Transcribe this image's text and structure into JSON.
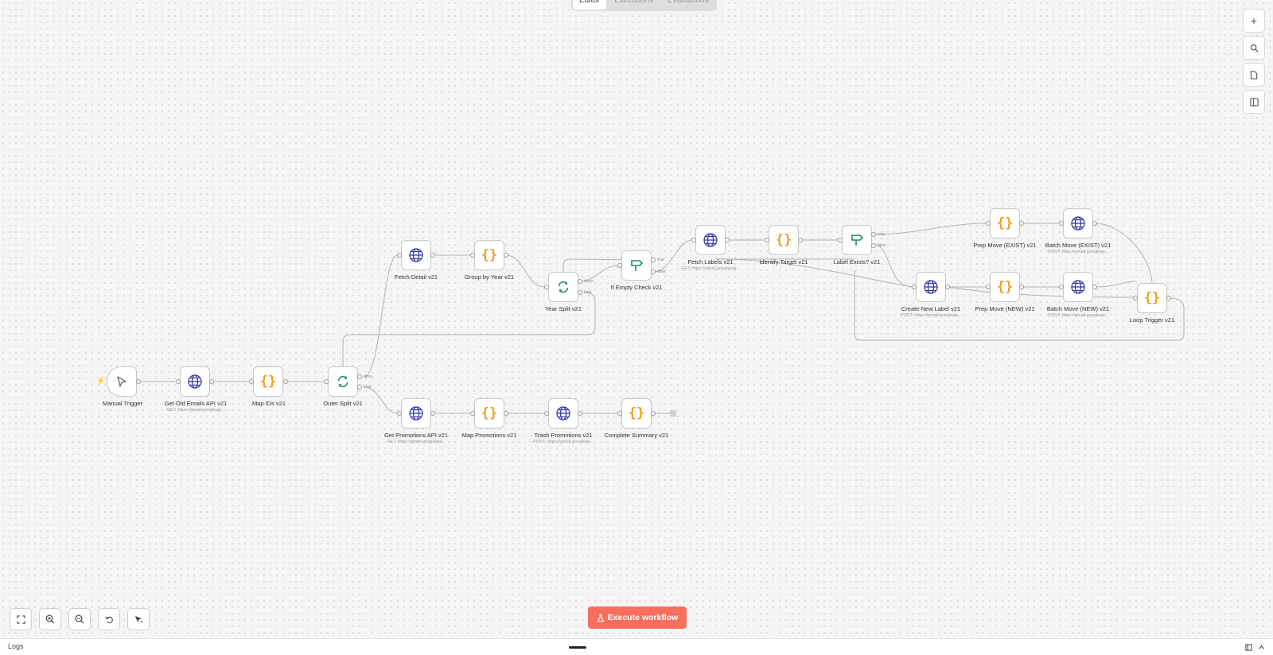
{
  "tabs": [
    "Editor",
    "Executions",
    "Evaluations"
  ],
  "canvas_tools": {
    "right": [
      {
        "name": "add-node-button",
        "icon": "plus-icon"
      },
      {
        "name": "search-nodes-button",
        "icon": "search-icon"
      },
      {
        "name": "sticky-note-button",
        "icon": "note-icon"
      },
      {
        "name": "toggle-panel-button",
        "icon": "panel-icon"
      }
    ],
    "bottom": [
      {
        "name": "zoom-to-fit-button",
        "icon": "fullscreen-icon"
      },
      {
        "name": "zoom-in-button",
        "icon": "zoom-in-icon"
      },
      {
        "name": "zoom-out-button",
        "icon": "zoom-out-icon"
      },
      {
        "name": "reset-zoom-button",
        "icon": "undo-icon"
      },
      {
        "name": "tidy-up-button",
        "icon": "cursor-magic-icon"
      }
    ]
  },
  "execute_button": {
    "label": "Execute workflow",
    "icon": "flask-icon"
  },
  "logs": {
    "label": "Logs"
  },
  "colors": {
    "accent": "#f56f5c",
    "code": "#f0a021",
    "http": "#3b3aa8",
    "flow": "#1f8f5f"
  },
  "nodes": {
    "trigger": {
      "label": "Manual Trigger",
      "icon": "cursor-icon"
    },
    "get_old": {
      "label": "Get Old Emails API v21",
      "sub": "GET: https://gmail.googleapi...",
      "icon": "globe-icon"
    },
    "map_ids": {
      "label": "Map IDs v21",
      "icon": "code-icon"
    },
    "outer_split": {
      "label": "Outer Split v21",
      "icon": "loop-icon",
      "ports": [
        "done",
        "loop"
      ]
    },
    "fetch_detail": {
      "label": "Fetch Detail v21",
      "icon": "globe-icon"
    },
    "group_year": {
      "label": "Group by Year v21",
      "icon": "code-icon"
    },
    "year_split": {
      "label": "Year Split v21",
      "icon": "loop-icon",
      "ports": [
        "done",
        "loop"
      ]
    },
    "if_empty": {
      "label": "If Empty Check v21",
      "icon": "signpost-icon",
      "ports": [
        "true",
        "false"
      ]
    },
    "fetch_labels": {
      "label": "Fetch Labels v21",
      "sub": "GET: https://gmail.googleapi...",
      "icon": "globe-icon"
    },
    "identify": {
      "label": "Identify Target v21",
      "icon": "code-icon"
    },
    "label_exists": {
      "label": "Label Exists? v21",
      "icon": "signpost-icon",
      "ports": [
        "true",
        "false"
      ]
    },
    "prep_exist": {
      "label": "Prep Move (EXIST) v21",
      "icon": "code-icon"
    },
    "batch_exist": {
      "label": "Batch Move (EXIST) v21",
      "sub": "POST: https://gmail.googleap...",
      "icon": "globe-icon"
    },
    "create_label": {
      "label": "Create New Label v21",
      "sub": "POST: https://gmail.googleap...",
      "icon": "globe-icon"
    },
    "prep_new": {
      "label": "Prep Move (NEW) v21",
      "icon": "code-icon"
    },
    "batch_new": {
      "label": "Batch Move (NEW) v21",
      "sub": "POST: https://gmail.googleap...",
      "icon": "globe-icon"
    },
    "loop_trigger": {
      "label": "Loop Trigger v21",
      "icon": "code-icon"
    },
    "get_promos": {
      "label": "Get Promotions API v21",
      "sub": "GET: https://gmail.googleapi...",
      "icon": "globe-icon"
    },
    "map_promos": {
      "label": "Map Promotions v21",
      "icon": "code-icon"
    },
    "trash_promos": {
      "label": "Trash Promotions v21",
      "sub": "POST: https://gmail.googleap...",
      "icon": "globe-icon"
    },
    "summary": {
      "label": "Complete Summary v21",
      "icon": "code-icon"
    }
  }
}
